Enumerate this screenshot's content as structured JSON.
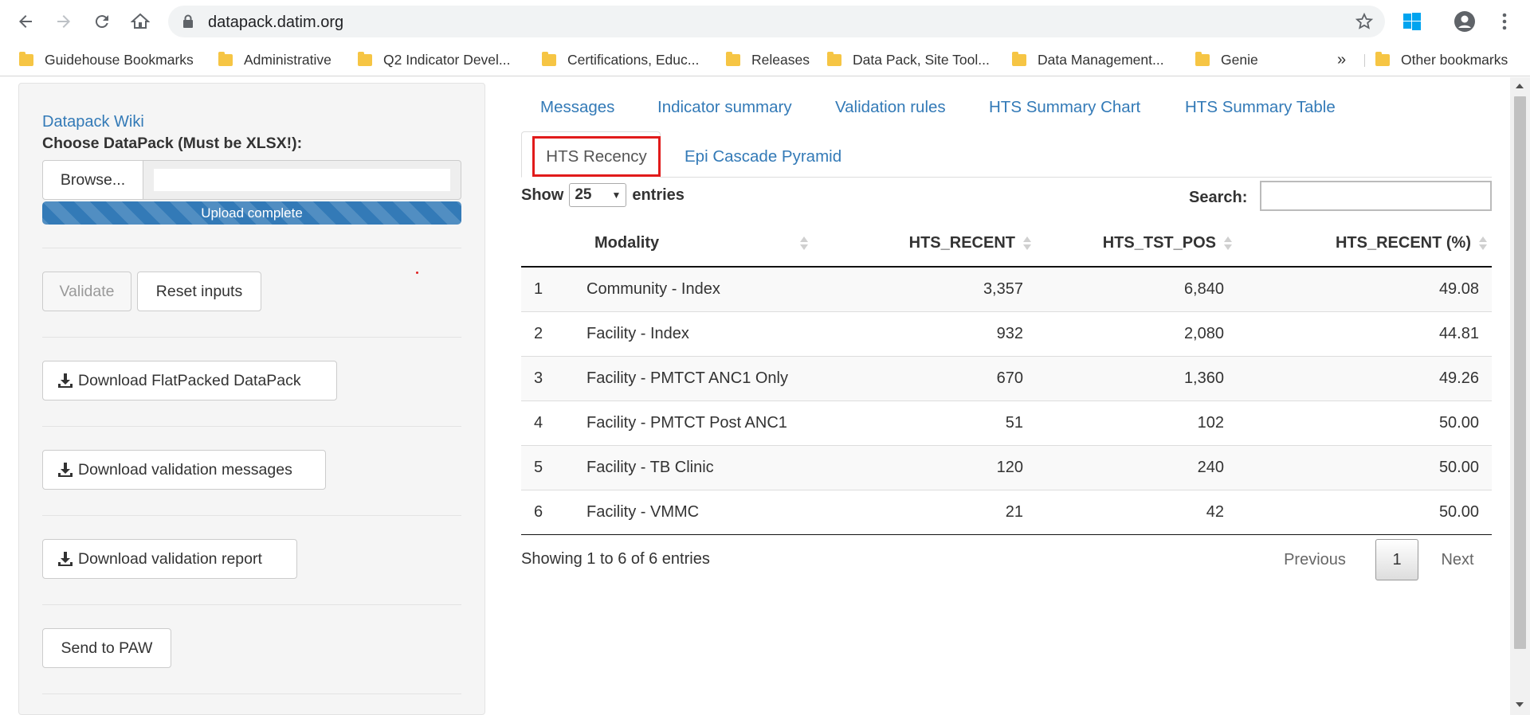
{
  "browser": {
    "url": "datapack.datim.org",
    "bookmarks": [
      "Guidehouse Bookmarks",
      "Administrative",
      "Q2 Indicator Devel...",
      "Certifications, Educ...",
      "Releases",
      "Data Pack, Site Tool...",
      "Data Management...",
      "Genie"
    ],
    "more_label": "»",
    "other_bookmarks": "Other bookmarks"
  },
  "sidebar": {
    "wiki_link": "Datapack Wiki",
    "choose_label": "Choose DataPack (Must be XLSX!):",
    "browse_label": "Browse...",
    "upload_status": "Upload complete",
    "validate_label": "Validate",
    "reset_label": "Reset inputs",
    "download_flat_label": "Download FlatPacked DataPack",
    "download_messages_label": "Download validation messages",
    "download_report_label": "Download validation report",
    "send_paw_label": "Send to PAW"
  },
  "tabs": {
    "messages": "Messages",
    "indicator_summary": "Indicator summary",
    "validation_rules": "Validation rules",
    "hts_summary_chart": "HTS Summary Chart",
    "hts_summary_table": "HTS Summary Table",
    "hts_recency": "HTS Recency",
    "epi_cascade": "Epi Cascade Pyramid"
  },
  "table": {
    "show_label": "Show",
    "entries_label": "entries",
    "page_length": "25",
    "search_label": "Search:",
    "search_value": "",
    "columns": [
      "",
      "Modality",
      "HTS_RECENT",
      "HTS_TST_POS",
      "HTS_RECENT (%)"
    ],
    "rows": [
      [
        "1",
        "Community - Index",
        "3,357",
        "6,840",
        "49.08"
      ],
      [
        "2",
        "Facility - Index",
        "932",
        "2,080",
        "44.81"
      ],
      [
        "3",
        "Facility - PMTCT ANC1 Only",
        "670",
        "1,360",
        "49.26"
      ],
      [
        "4",
        "Facility - PMTCT Post ANC1",
        "51",
        "102",
        "50.00"
      ],
      [
        "5",
        "Facility - TB Clinic",
        "120",
        "240",
        "50.00"
      ],
      [
        "6",
        "Facility - VMMC",
        "21",
        "42",
        "50.00"
      ]
    ],
    "info": "Showing 1 to 6 of 6 entries",
    "previous_label": "Previous",
    "current_page": "1",
    "next_label": "Next"
  },
  "colors": {
    "link": "#337ab7",
    "highlight": "#e11b1b",
    "folder": "#f6c544"
  }
}
